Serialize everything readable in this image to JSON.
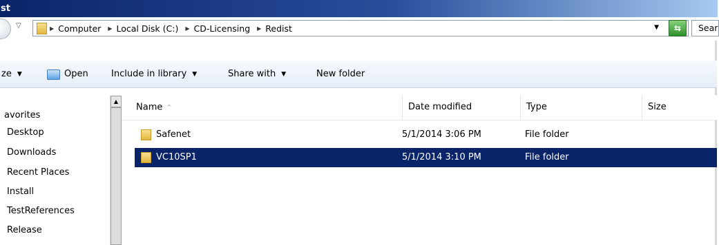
{
  "window": {
    "title": "st"
  },
  "address": {
    "crumbs": [
      "Computer",
      "Local Disk (C:)",
      "CD-Licensing",
      "Redist"
    ],
    "search_placeholder": "Sear"
  },
  "toolbar": {
    "organize_label": "ze",
    "open_label": "Open",
    "include_label": "Include in library",
    "share_label": "Share with",
    "new_folder_label": "New folder"
  },
  "nav": {
    "items": [
      "avorites",
      "Desktop",
      "Downloads",
      "Recent Places",
      "Install",
      "TestReferences",
      "Release"
    ]
  },
  "columns": {
    "name": "Name",
    "date": "Date modified",
    "type": "Type",
    "size": "Size"
  },
  "files": [
    {
      "name": "Safenet",
      "date": "5/1/2014 3:06 PM",
      "type": "File folder",
      "size": "",
      "selected": false
    },
    {
      "name": "VC10SP1",
      "date": "5/1/2014 3:10 PM",
      "type": "File folder",
      "size": "",
      "selected": true
    }
  ],
  "colors": {
    "selection": "#0a246a",
    "titlebar": "#0a246a"
  },
  "icons": [
    "back-icon",
    "folder-icon",
    "refresh-icon",
    "open-folder-icon",
    "sort-ascending-icon",
    "scroll-up-icon"
  ]
}
